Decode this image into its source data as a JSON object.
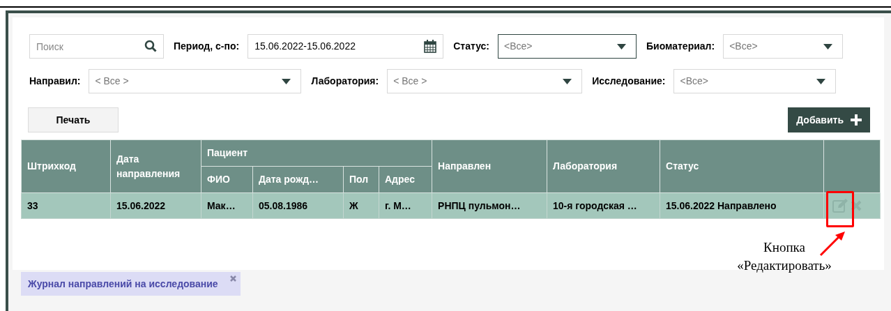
{
  "filters_row_1": [
    {
      "kind": "search",
      "placeholder": "Поиск"
    },
    {
      "kind": "date",
      "label": "Период, с-по:",
      "value": "15.06.2022-15.06.2022"
    },
    {
      "kind": "select",
      "label": "Статус:",
      "value": "<Все>",
      "focused": true
    },
    {
      "kind": "select",
      "label": "Биоматериал:",
      "value": "<Все>",
      "focused": false
    }
  ],
  "filters_row_2": [
    {
      "kind": "select",
      "label": "Направил:",
      "value": "< Все >",
      "focused": false
    },
    {
      "kind": "select",
      "label": "Лаборатория:",
      "value": "< Все >",
      "focused": false
    },
    {
      "kind": "select",
      "label": "Исследование:",
      "value": "<Все>",
      "focused": false
    }
  ],
  "print_button": "Печать",
  "add_button": "Добавить",
  "table": {
    "group_heading": "Пациент",
    "columns": [
      "Штрихкод",
      "Дата направления",
      "ФИО",
      "Дата рожд…",
      "Пол",
      "Адрес",
      "Направлен",
      "Лаборатория",
      "Статус"
    ],
    "rows": [
      {
        "selected": true,
        "cells": [
          "33",
          "15.06.2022",
          "Мак…",
          "05.08.1986",
          "Ж",
          "г. М…",
          "РНПЦ пульмон…",
          "10-я городская …",
          "15.06.2022 Направлено"
        ]
      }
    ]
  },
  "annotation": {
    "lines": [
      "Кнопка",
      "«Редактировать»"
    ]
  },
  "tabs": [
    {
      "label": "Журнал направлений на исследование",
      "selected": true
    }
  ]
}
